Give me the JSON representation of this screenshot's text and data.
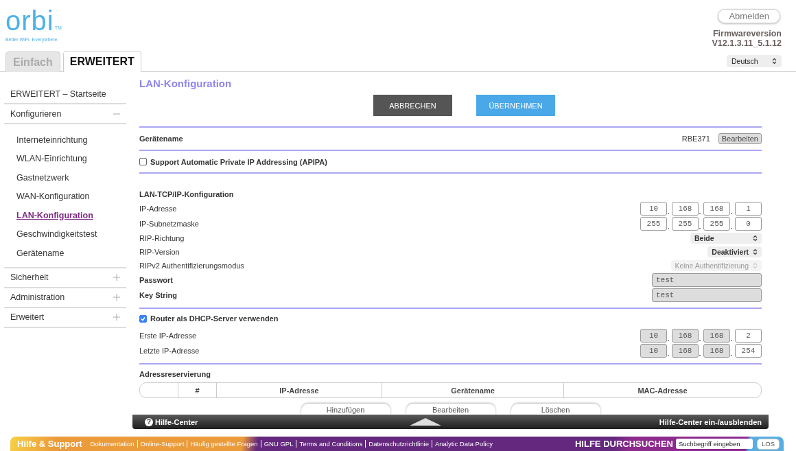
{
  "header": {
    "logo": {
      "wordmark": "orbi",
      "trademark": "TM",
      "tagline": "Better WiFi. Everywhere."
    },
    "logout_button": "Abmelden",
    "firmware_label": "Firmwareversion",
    "firmware_version": "V12.1.3.11_5.1.12",
    "language_select": "Deutsch"
  },
  "tabs": [
    {
      "label": "Einfach",
      "selected": false
    },
    {
      "label": "ERWEITERT",
      "selected": true
    }
  ],
  "sidebar": {
    "items": [
      {
        "label": "ERWEITERT – Startseite",
        "selected": false
      },
      {
        "label": "Konfigurieren",
        "selected": false,
        "expanded": true,
        "children": [
          {
            "label": "Interneteinrichtung",
            "selected": false
          },
          {
            "label": "WLAN-Einrichtung",
            "selected": false
          },
          {
            "label": "Gastnetzwerk",
            "selected": false
          },
          {
            "label": "WAN-Konfiguration",
            "selected": false
          },
          {
            "label": "LAN-Konfiguration",
            "selected": true
          },
          {
            "label": "Geschwindigkeitstest",
            "selected": false
          },
          {
            "label": "Gerätename",
            "selected": false
          }
        ]
      },
      {
        "label": "Sicherheit",
        "selected": false,
        "expanded": false
      },
      {
        "label": "Administration",
        "selected": false,
        "expanded": false
      },
      {
        "label": "Erweitert",
        "selected": false,
        "expanded": false
      }
    ]
  },
  "content": {
    "title": "LAN-Konfiguration",
    "buttons": [
      {
        "label": "ABBRECHEN",
        "kind": "cancel"
      },
      {
        "label": "ÜBERNEHMEN",
        "kind": "apply"
      }
    ],
    "device_name": {
      "label": "Gerätename",
      "value": "RBE371",
      "button": "Bearbeiten"
    },
    "apipa": {
      "label": "Support Automatic Private IP Addressing (APIPA)",
      "checked": false
    },
    "lan_tcp": {
      "heading": "LAN-TCP/IP-Konfiguration",
      "rows": [
        {
          "kind": "ip",
          "label": "IP-Adresse",
          "octets": [
            {
              "value": "10",
              "disabled": false
            },
            {
              "value": "168",
              "disabled": false
            },
            {
              "value": "168",
              "disabled": false
            },
            {
              "value": "1",
              "disabled": false
            }
          ]
        },
        {
          "kind": "ip",
          "label": "IP-Subnetzmaske",
          "octets": [
            {
              "value": "255",
              "disabled": false
            },
            {
              "value": "255",
              "disabled": false
            },
            {
              "value": "255",
              "disabled": false
            },
            {
              "value": "0",
              "disabled": false
            }
          ]
        },
        {
          "kind": "select",
          "label": "RIP-Richtung",
          "value": "Beide",
          "disabled": false
        },
        {
          "kind": "select",
          "label": "RIP-Version",
          "value": "Deaktiviert",
          "disabled": false
        },
        {
          "kind": "select",
          "label": "RIPv2 Authentifizierungsmodus",
          "value": "Keine Authentifizierung",
          "disabled": true
        },
        {
          "kind": "text",
          "label": "Passwort",
          "value": "test",
          "disabled": true
        },
        {
          "kind": "text",
          "label": "Key String",
          "value": "test",
          "disabled": true
        }
      ]
    },
    "dhcp": {
      "label": "Router als DHCP-Server verwenden",
      "checked": true,
      "rows": [
        {
          "kind": "ip",
          "label": "Erste IP-Adresse",
          "octets": [
            {
              "value": "10",
              "disabled": true
            },
            {
              "value": "168",
              "disabled": true
            },
            {
              "value": "168",
              "disabled": true
            },
            {
              "value": "2",
              "disabled": false
            }
          ]
        },
        {
          "kind": "ip",
          "label": "Letzte IP-Adresse",
          "octets": [
            {
              "value": "10",
              "disabled": true
            },
            {
              "value": "168",
              "disabled": true
            },
            {
              "value": "168",
              "disabled": true
            },
            {
              "value": "254",
              "disabled": false
            }
          ]
        }
      ]
    },
    "reservation": {
      "heading": "Adressreservierung",
      "columns": [
        "#",
        "IP-Adresse",
        "Gerätename",
        "MAC-Adresse"
      ],
      "buttons": [
        "Hinzufügen",
        "Bearbeiten",
        "Löschen"
      ]
    }
  },
  "help_bar": {
    "icon": "?",
    "title": "Hilfe-Center",
    "toggle": "Hilfe-Center ein-/ausblenden"
  },
  "footer": {
    "title": "Hilfe & Support",
    "links": [
      "Dokumentation",
      "Online-Support",
      "Häufig gestellte Fragen",
      "GNU GPL",
      "Terms and Conditions",
      "Datenschutzrichtlinie",
      "Analytic Data Policy"
    ],
    "search_title": "HILFE DURCHSUCHEN",
    "search_placeholder": "Suchbegriff eingeben",
    "search_button": "LOS"
  }
}
